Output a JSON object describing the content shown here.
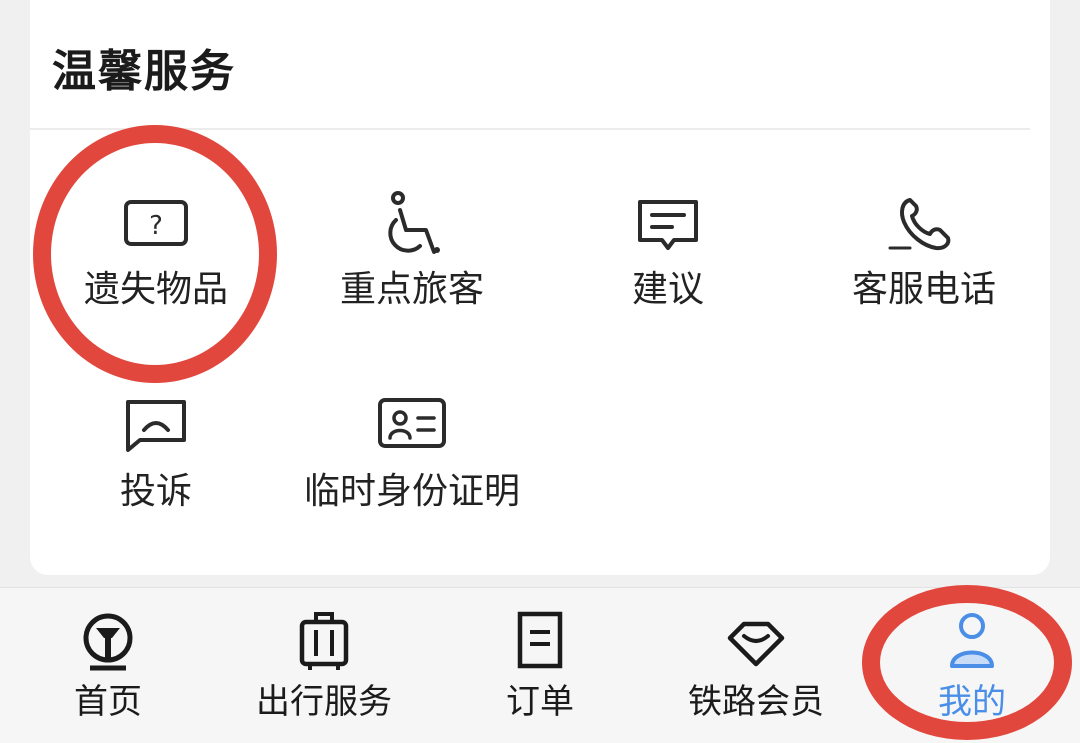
{
  "section": {
    "title": "温馨服务"
  },
  "services": [
    {
      "label": "遗失物品",
      "icon": "lost-item-icon"
    },
    {
      "label": "重点旅客",
      "icon": "wheelchair-icon"
    },
    {
      "label": "建议",
      "icon": "suggestion-icon"
    },
    {
      "label": "客服电话",
      "icon": "phone-icon"
    },
    {
      "label": "投诉",
      "icon": "complaint-icon"
    },
    {
      "label": "临时身份证明",
      "icon": "id-card-icon"
    }
  ],
  "tabbar": {
    "items": [
      {
        "label": "首页",
        "icon": "railway-logo-icon",
        "active": false
      },
      {
        "label": "出行服务",
        "icon": "luggage-icon",
        "active": false
      },
      {
        "label": "订单",
        "icon": "order-icon",
        "active": false
      },
      {
        "label": "铁路会员",
        "icon": "diamond-icon",
        "active": false
      },
      {
        "label": "我的",
        "icon": "user-icon",
        "active": true
      }
    ]
  },
  "colors": {
    "annotation": "#e2473d",
    "active_tab": "#4a8ee8",
    "icon_stroke": "#2b2b2b"
  }
}
